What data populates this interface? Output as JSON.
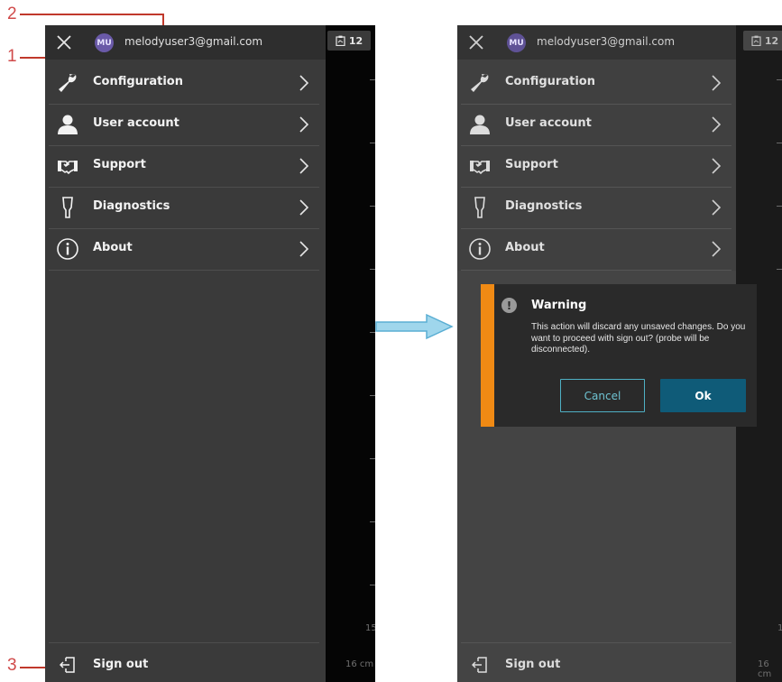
{
  "annotations": {
    "callout_1": "1",
    "callout_2": "2",
    "callout_3": "3"
  },
  "colors": {
    "accent_warning": "#f08a14",
    "ok_button": "#0f5b78",
    "cancel_border": "#4fb0c4",
    "avatar": "#6a5aa8",
    "callout": "#d04a4a",
    "arrow": "#7fc6e3"
  },
  "drawer": {
    "avatar_initials": "MU",
    "email": "melodyuser3@gmail.com",
    "items": [
      {
        "label": "Configuration",
        "icon": "wrench-icon"
      },
      {
        "label": "User account",
        "icon": "user-icon"
      },
      {
        "label": "Support",
        "icon": "handshake-icon"
      },
      {
        "label": "Diagnostics",
        "icon": "probe-icon"
      },
      {
        "label": "About",
        "icon": "info-icon"
      }
    ],
    "signout_label": "Sign out"
  },
  "status": {
    "badge_value": "12",
    "depth_value": "15",
    "depth_label": "16 cm"
  },
  "dialog": {
    "title": "Warning",
    "message": "This action will discard any unsaved changes. Do you want to proceed with sign out? (probe will be disconnected).",
    "cancel_label": "Cancel",
    "ok_label": "Ok"
  }
}
